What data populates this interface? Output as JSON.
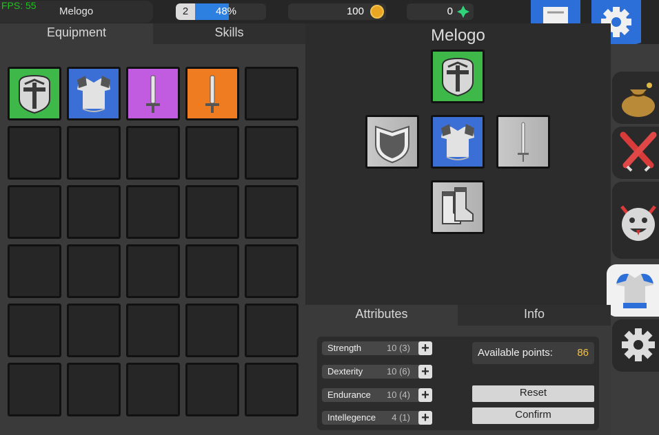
{
  "hud": {
    "fps": "FPS: 55",
    "player_name": "Melogo",
    "level": "2",
    "xp_percent_text": "48%",
    "xp_fraction": 0.48,
    "gold": "100",
    "gems": "0"
  },
  "tabs_top": {
    "equipment": "Equipment",
    "skills": "Skills"
  },
  "inventory": {
    "rows": 6,
    "cols": 5,
    "items": [
      {
        "slot": 0,
        "icon": "helmet-icon",
        "rarity_color": "#3fb84a"
      },
      {
        "slot": 1,
        "icon": "chest-armor-icon",
        "rarity_color": "#3b6fd6"
      },
      {
        "slot": 2,
        "icon": "sword-icon",
        "rarity_color": "#c15ce0"
      },
      {
        "slot": 3,
        "icon": "sword-icon",
        "rarity_color": "#f07c22"
      }
    ]
  },
  "character": {
    "name": "Melogo",
    "equipped": {
      "head": {
        "icon": "helmet-icon",
        "rarity_color": "#3fb84a"
      },
      "offhand": {
        "icon": "shield-placeholder-icon",
        "rarity_color": "#bdbdbd"
      },
      "chest": {
        "icon": "chest-armor-icon",
        "rarity_color": "#3b6fd6"
      },
      "weapon": {
        "icon": "sword-placeholder-icon",
        "rarity_color": "#bdbdbd"
      },
      "feet": {
        "icon": "boots-placeholder-icon",
        "rarity_color": "#bdbdbd"
      }
    }
  },
  "side_tabs": [
    {
      "icon": "loot-bag-icon",
      "active": false
    },
    {
      "icon": "crossed-swords-icon",
      "active": false
    },
    {
      "icon": "monster-face-icon",
      "active": false
    },
    {
      "icon": "armor-icon",
      "active": true
    },
    {
      "icon": "gear-icon",
      "active": false
    }
  ],
  "tabs_bottom": {
    "attributes": "Attributes",
    "info": "Info"
  },
  "attributes": [
    {
      "label": "Strength",
      "value": "10 (3)"
    },
    {
      "label": "Dexterity",
      "value": "10 (6)"
    },
    {
      "label": "Endurance",
      "value": "10 (4)"
    },
    {
      "label": "Intellegence",
      "value": "4 (1)"
    }
  ],
  "points": {
    "label": "Available points:",
    "value": "86"
  },
  "buttons": {
    "reset": "Reset",
    "confirm": "Confirm"
  },
  "colors": {
    "accent_blue": "#2d7fe0",
    "gold": "#f5c342",
    "fps_green": "#1ec41e"
  }
}
